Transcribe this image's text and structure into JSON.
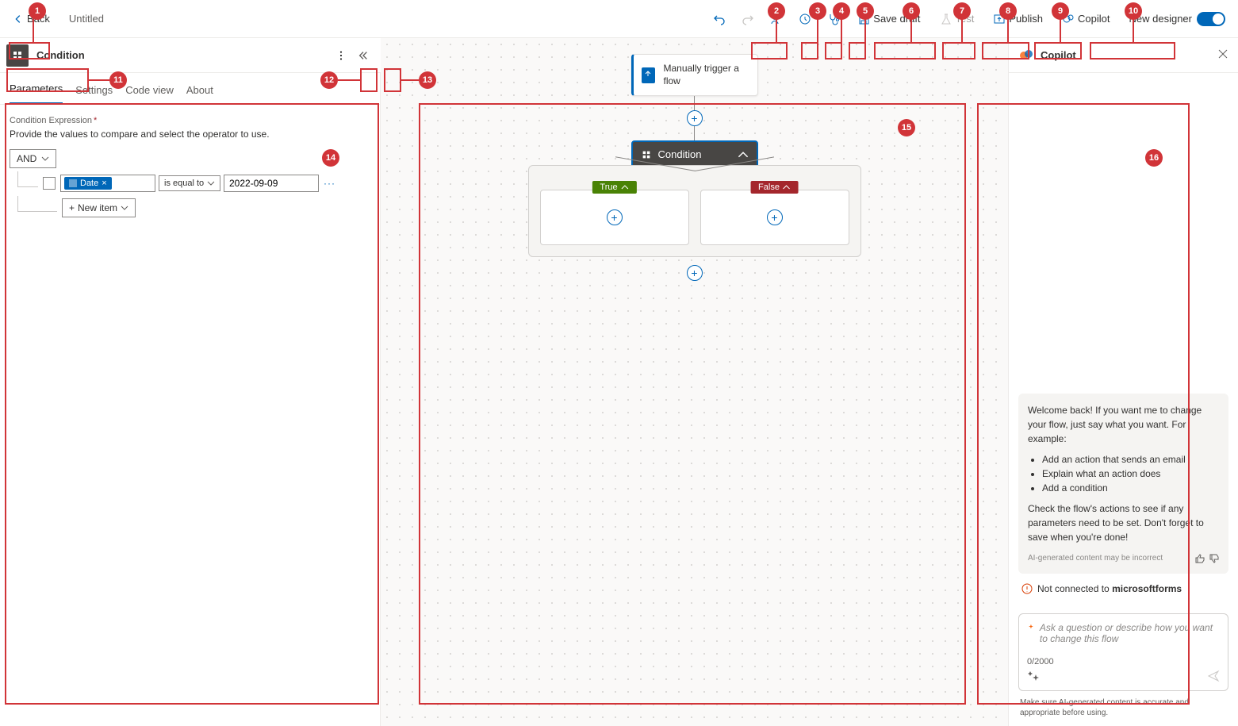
{
  "toolbar": {
    "back_label": "Back",
    "flow_title": "Untitled",
    "save_draft": "Save draft",
    "test": "Test",
    "publish": "Publish",
    "copilot": "Copilot",
    "new_designer": "New designer"
  },
  "panel": {
    "step_name": "Condition",
    "tabs": {
      "parameters": "Parameters",
      "settings": "Settings",
      "code_view": "Code view",
      "about": "About"
    },
    "field_label": "Condition Expression",
    "field_desc": "Provide the values to compare and select the operator to use.",
    "group_op": "AND",
    "row": {
      "token": "Date",
      "operator": "is equal to",
      "value": "2022-09-09"
    },
    "new_item": "New item"
  },
  "canvas": {
    "trigger_label": "Manually trigger a flow",
    "condition_label": "Condition",
    "branch_true": "True",
    "branch_false": "False"
  },
  "copilot": {
    "title": "Copilot",
    "welcome_intro": "Welcome back! If you want me to change your flow, just say what you want. For example:",
    "examples": [
      "Add an action that sends an email",
      "Explain what an action does",
      "Add a condition"
    ],
    "welcome_outro": "Check the flow's actions to see if any parameters need to be set. Don't forget to save when you're done!",
    "ai_note": "AI-generated content may be incorrect",
    "not_connected_prefix": "Not connected to ",
    "not_connected_target": "microsoftforms",
    "placeholder": "Ask a question or describe how you want to change this flow",
    "count": "0/2000",
    "disclaimer": "Make sure AI-generated content is accurate and appropriate before using."
  },
  "markers": [
    "1",
    "2",
    "3",
    "4",
    "5",
    "6",
    "7",
    "8",
    "9",
    "10",
    "11",
    "12",
    "13",
    "14",
    "15",
    "16"
  ]
}
